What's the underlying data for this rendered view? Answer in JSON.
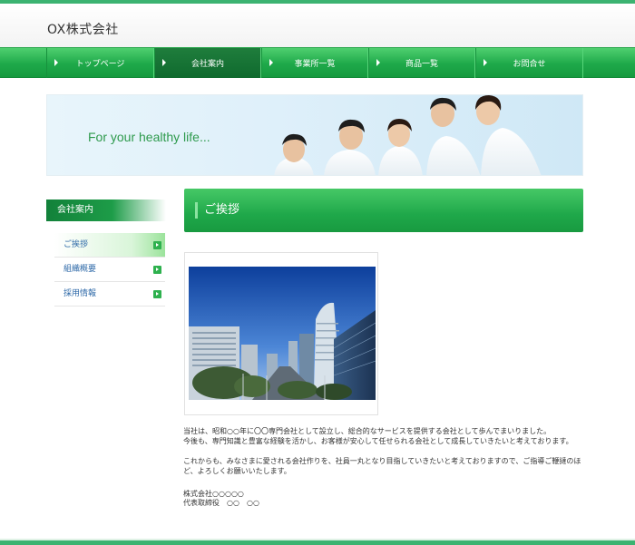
{
  "header": {
    "logo": "OX株式会社"
  },
  "nav": {
    "items": [
      {
        "label": "トップページ",
        "active": false
      },
      {
        "label": "会社案内",
        "active": true
      },
      {
        "label": "事業所一覧",
        "active": false
      },
      {
        "label": "商品一覧",
        "active": false
      },
      {
        "label": "お問合せ",
        "active": false
      }
    ]
  },
  "hero": {
    "text": "For your healthy life..."
  },
  "sidebar": {
    "title": "会社案内",
    "items": [
      {
        "label": "ご挨拶",
        "active": true
      },
      {
        "label": "組織概要",
        "active": false
      },
      {
        "label": "採用情報",
        "active": false
      }
    ]
  },
  "content": {
    "title": "ご挨拶",
    "paragraph1_line1": "当社は、昭和○○年に〇〇専門会社として設立し、総合的なサービスを提供する会社として歩んでまいりました。",
    "paragraph1_line2": "今後も、専門知識と豊富な経験を活かし、お客様が安心して任せられる会社として成長していきたいと考えております。",
    "paragraph2": "これからも、みなさまに愛される会社作りを、社員一丸となり目指していきたいと考えておりますので、ご指導ご鞭撻のほど、よろしくお願いいたします。",
    "signature_company": "株式会社○○○○○",
    "signature_name": "代表取締役　○○　○○"
  },
  "colors": {
    "accent": "#1ea94a",
    "accent_dark": "#0f6a2e",
    "link": "#2f6aa8"
  }
}
